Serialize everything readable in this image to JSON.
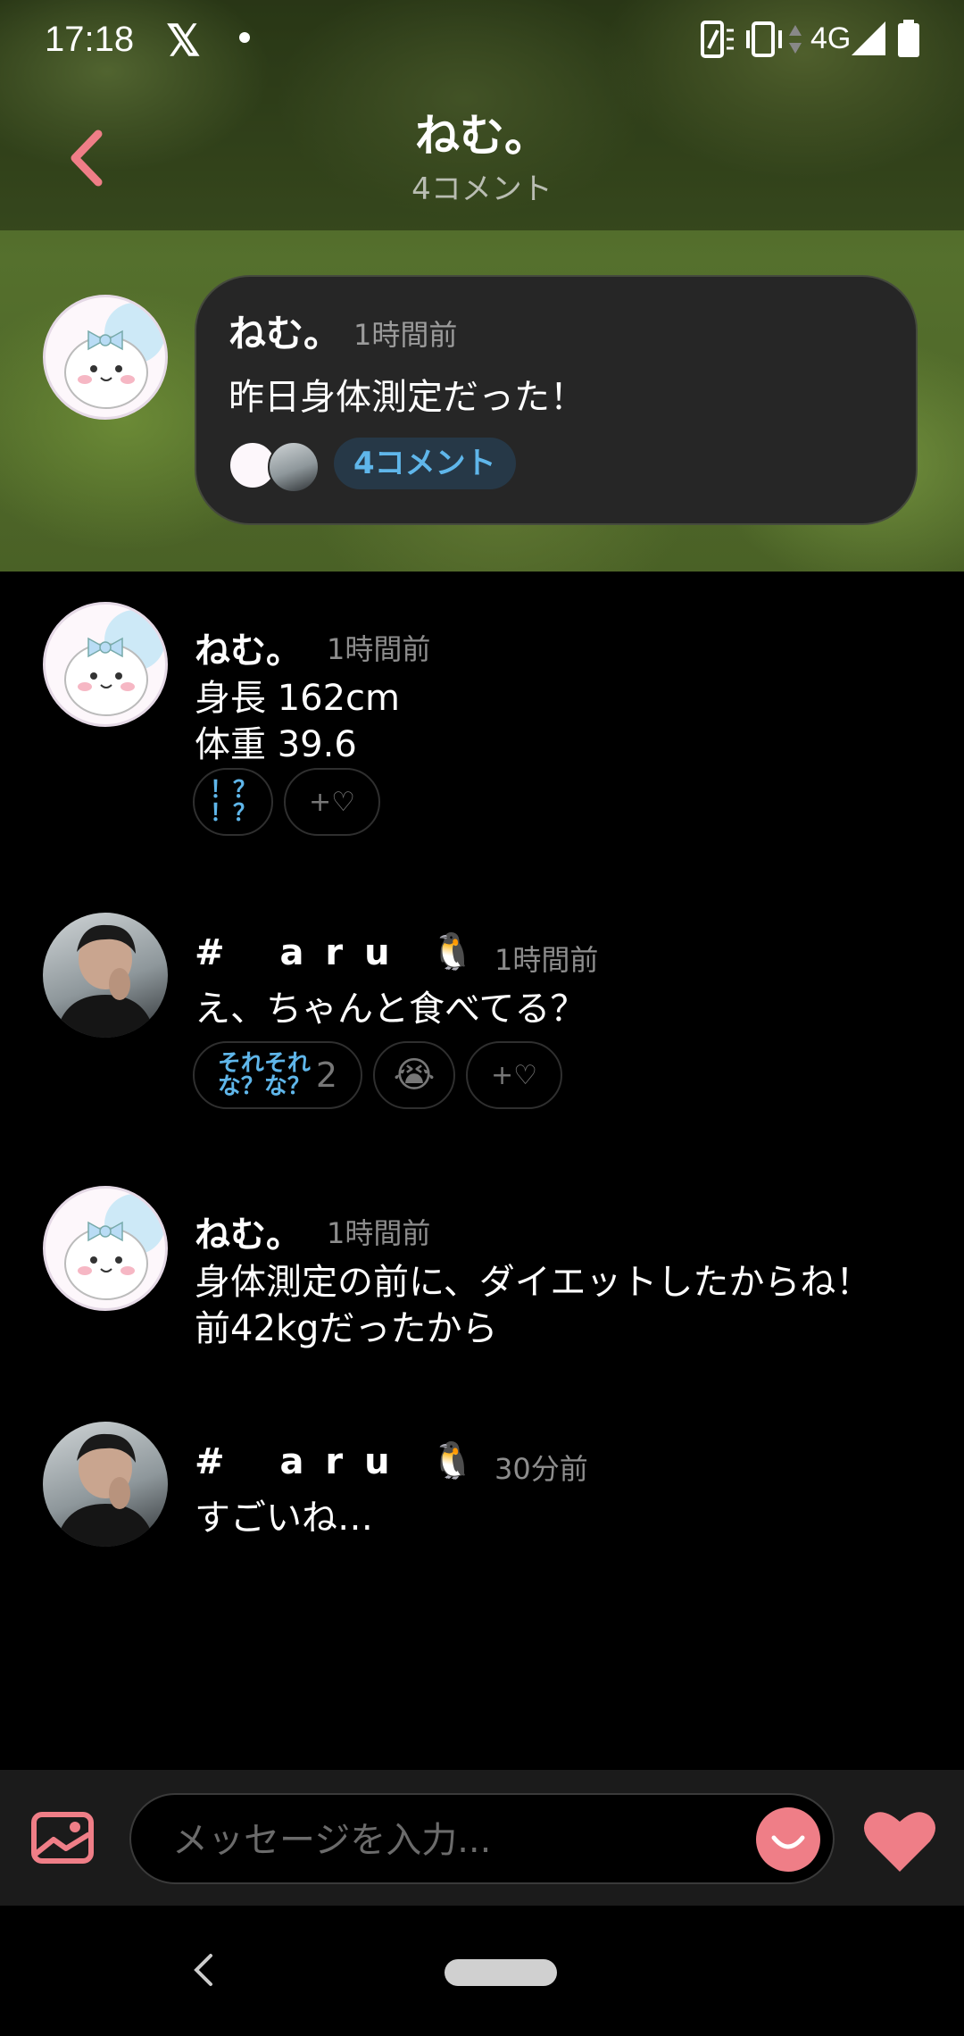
{
  "status_bar": {
    "time": "17:18",
    "network": "4G"
  },
  "header": {
    "title": "ねむ。",
    "subtitle": "4コメント"
  },
  "post": {
    "author": "ねむ。",
    "time": "1時間前",
    "text": "昨日身体測定だった！",
    "comment_badge": "4コメント"
  },
  "comments": [
    {
      "author": "ねむ。",
      "time": "1時間前",
      "text": "身長 162cm\n体重 39.6",
      "reaction": "！？\n！？"
    },
    {
      "author": "# aru .",
      "time": "1時間前",
      "text": "え、ちゃんと食べてる？",
      "reaction_text": "それそれ\nな？な？",
      "reaction_count": "2",
      "emoji": "😭"
    },
    {
      "author": "ねむ。",
      "time": "1時間前",
      "text": "身体測定の前に、ダイエットしたからね！\n前42kgだったから"
    },
    {
      "author": "# aru .",
      "time": "30分前",
      "text": "すごいね…"
    }
  ],
  "add_reaction_label": "+♡",
  "penguin_emoji": "🐧",
  "composer": {
    "placeholder": "メッセージを入力..."
  },
  "colors": {
    "accent": "#ef7e87",
    "link": "#5fb6ea"
  }
}
